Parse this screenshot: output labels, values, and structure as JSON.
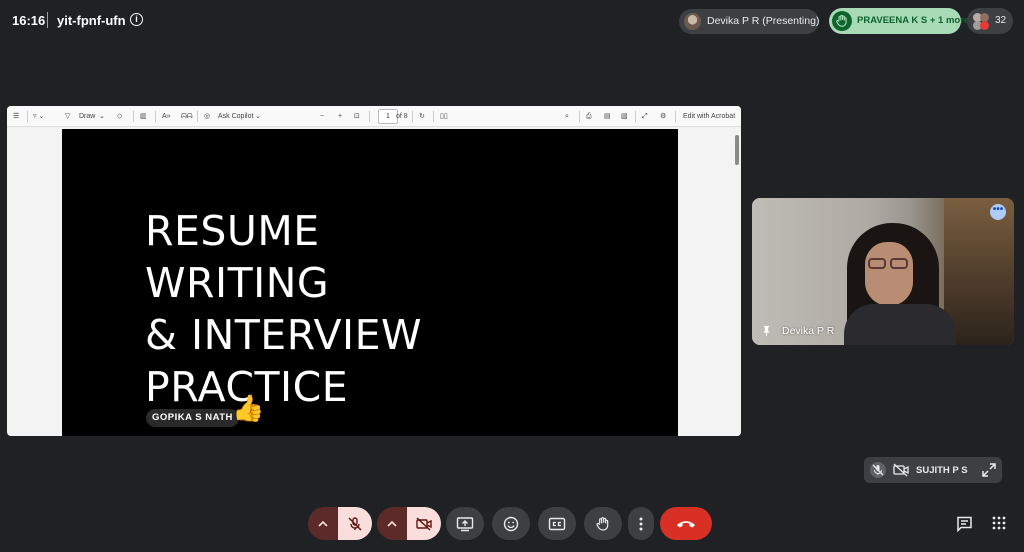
{
  "meeting": {
    "time": "16:16",
    "code": "yit-fpnf-ufn"
  },
  "top_right": {
    "presenter_chip": "Devika P R (Presenting)",
    "raised_hands_chip": "PRAVEENA K S + 1 more",
    "participant_count": "32"
  },
  "pdf_toolbar": {
    "draw_label": "Draw",
    "copilot_label": "Ask Copilot",
    "page_current": "1",
    "page_total": "of 8",
    "edit_label": "Edit with Acrobat"
  },
  "slide": {
    "title_lines": [
      "RESUME",
      "WRITING",
      "& INTERVIEW",
      "PRACTICE"
    ],
    "author": "GOPIKA S NATH",
    "reaction": "👍"
  },
  "video_tile": {
    "name": "Devika P R"
  },
  "self_tile": {
    "name": "SUJITH P S"
  },
  "colors": {
    "background": "#202124",
    "raised_hand_chip": "#a8dab5",
    "hangup": "#d93025",
    "muted_control": "#f9dedc"
  },
  "icons": [
    "info-icon",
    "hand-icon",
    "mic-off-icon",
    "camera-off-icon",
    "present-icon",
    "emoji-icon",
    "captions-icon",
    "raise-hand-icon",
    "more-icon",
    "hangup-icon",
    "chat-icon",
    "activities-icon",
    "pin-icon",
    "expand-icon"
  ]
}
